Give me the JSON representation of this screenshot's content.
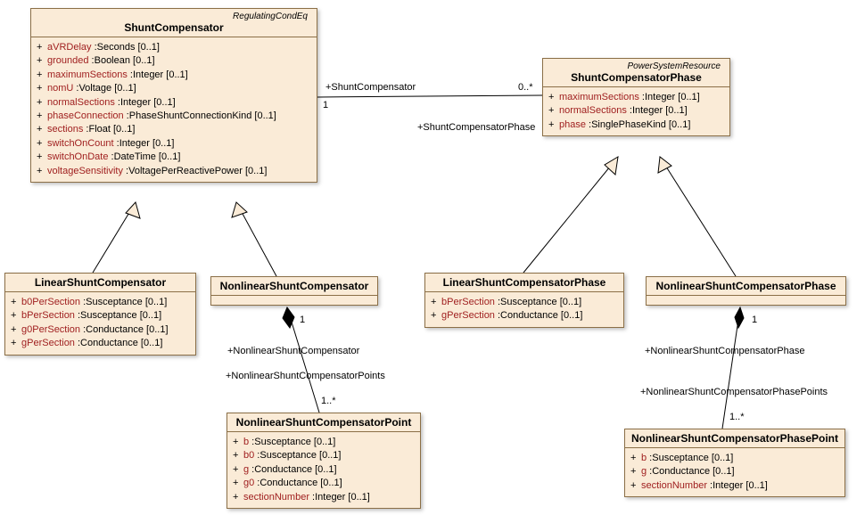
{
  "classes": {
    "shuntCompensator": {
      "stereotype": "RegulatingCondEq",
      "name": "ShuntCompensator",
      "attrs": [
        {
          "vis": "+",
          "name": "aVRDelay",
          "rest": "  :Seconds [0..1]"
        },
        {
          "vis": "+",
          "name": "grounded",
          "rest": "  :Boolean [0..1]"
        },
        {
          "vis": "+",
          "name": "maximumSections",
          "rest": "  :Integer [0..1]"
        },
        {
          "vis": "+",
          "name": "nomU",
          "rest": "  :Voltage [0..1]"
        },
        {
          "vis": "+",
          "name": "normalSections",
          "rest": "  :Integer [0..1]"
        },
        {
          "vis": "+",
          "name": "phaseConnection",
          "rest": "  :PhaseShuntConnectionKind [0..1]"
        },
        {
          "vis": "+",
          "name": "sections",
          "rest": "  :Float [0..1]"
        },
        {
          "vis": "+",
          "name": "switchOnCount",
          "rest": "  :Integer [0..1]"
        },
        {
          "vis": "+",
          "name": "switchOnDate",
          "rest": "  :DateTime [0..1]"
        },
        {
          "vis": "+",
          "name": "voltageSensitivity",
          "rest": "  :VoltagePerReactivePower [0..1]"
        }
      ]
    },
    "shuntCompensatorPhase": {
      "stereotype": "PowerSystemResource",
      "name": "ShuntCompensatorPhase",
      "attrs": [
        {
          "vis": "+",
          "name": "maximumSections",
          "rest": "  :Integer [0..1]"
        },
        {
          "vis": "+",
          "name": "normalSections",
          "rest": "  :Integer [0..1]"
        },
        {
          "vis": "+",
          "name": "phase",
          "rest": "  :SinglePhaseKind [0..1]"
        }
      ]
    },
    "linearShuntCompensator": {
      "name": "LinearShuntCompensator",
      "attrs": [
        {
          "vis": "+",
          "name": "b0PerSection",
          "rest": "  :Susceptance [0..1]"
        },
        {
          "vis": "+",
          "name": "bPerSection",
          "rest": "  :Susceptance [0..1]"
        },
        {
          "vis": "+",
          "name": "g0PerSection",
          "rest": "  :Conductance [0..1]"
        },
        {
          "vis": "+",
          "name": "gPerSection",
          "rest": "  :Conductance [0..1]"
        }
      ]
    },
    "nonlinearShuntCompensator": {
      "name": "NonlinearShuntCompensator",
      "attrs": []
    },
    "nonlinearShuntCompensatorPoint": {
      "name": "NonlinearShuntCompensatorPoint",
      "attrs": [
        {
          "vis": "+",
          "name": "b",
          "rest": "  :Susceptance [0..1]"
        },
        {
          "vis": "+",
          "name": "b0",
          "rest": "  :Susceptance [0..1]"
        },
        {
          "vis": "+",
          "name": "g",
          "rest": "  :Conductance [0..1]"
        },
        {
          "vis": "+",
          "name": "g0",
          "rest": "  :Conductance [0..1]"
        },
        {
          "vis": "+",
          "name": "sectionNumber",
          "rest": "  :Integer [0..1]"
        }
      ]
    },
    "linearShuntCompensatorPhase": {
      "name": "LinearShuntCompensatorPhase",
      "attrs": [
        {
          "vis": "+",
          "name": "bPerSection",
          "rest": "  :Susceptance [0..1]"
        },
        {
          "vis": "+",
          "name": "gPerSection",
          "rest": "  :Conductance [0..1]"
        }
      ]
    },
    "nonlinearShuntCompensatorPhase": {
      "name": "NonlinearShuntCompensatorPhase",
      "attrs": []
    },
    "nonlinearShuntCompensatorPhasePoint": {
      "name": "NonlinearShuntCompensatorPhasePoint",
      "attrs": [
        {
          "vis": "+",
          "name": "b",
          "rest": "  :Susceptance [0..1]"
        },
        {
          "vis": "+",
          "name": "g",
          "rest": "  :Conductance [0..1]"
        },
        {
          "vis": "+",
          "name": "sectionNumber",
          "rest": "  :Integer [0..1]"
        }
      ]
    }
  },
  "labels": {
    "assocSC": "+ShuntCompensator",
    "assocSCmult1": "1",
    "assocSCPmult": "0..*",
    "assocSCP": "+ShuntCompensatorPhase",
    "nsc1": "1",
    "nscRole": "+NonlinearShuntCompensator",
    "nscPointsRole": "+NonlinearShuntCompensatorPoints",
    "nscPointsMult": "1..*",
    "nscp1": "1",
    "nscpRole": "+NonlinearShuntCompensatorPhase",
    "nscpPointsRole": "+NonlinearShuntCompensatorPhasePoints",
    "nscpPointsMult": "1..*"
  },
  "chart_data": {
    "type": "uml-class-diagram",
    "classes": [
      {
        "name": "ShuntCompensator",
        "stereotype": "RegulatingCondEq",
        "attributes": [
          "aVRDelay:Seconds[0..1]",
          "grounded:Boolean[0..1]",
          "maximumSections:Integer[0..1]",
          "nomU:Voltage[0..1]",
          "normalSections:Integer[0..1]",
          "phaseConnection:PhaseShuntConnectionKind[0..1]",
          "sections:Float[0..1]",
          "switchOnCount:Integer[0..1]",
          "switchOnDate:DateTime[0..1]",
          "voltageSensitivity:VoltagePerReactivePower[0..1]"
        ]
      },
      {
        "name": "ShuntCompensatorPhase",
        "stereotype": "PowerSystemResource",
        "attributes": [
          "maximumSections:Integer[0..1]",
          "normalSections:Integer[0..1]",
          "phase:SinglePhaseKind[0..1]"
        ]
      },
      {
        "name": "LinearShuntCompensator",
        "attributes": [
          "b0PerSection:Susceptance[0..1]",
          "bPerSection:Susceptance[0..1]",
          "g0PerSection:Conductance[0..1]",
          "gPerSection:Conductance[0..1]"
        ]
      },
      {
        "name": "NonlinearShuntCompensator",
        "attributes": []
      },
      {
        "name": "NonlinearShuntCompensatorPoint",
        "attributes": [
          "b:Susceptance[0..1]",
          "b0:Susceptance[0..1]",
          "g:Conductance[0..1]",
          "g0:Conductance[0..1]",
          "sectionNumber:Integer[0..1]"
        ]
      },
      {
        "name": "LinearShuntCompensatorPhase",
        "attributes": [
          "bPerSection:Susceptance[0..1]",
          "gPerSection:Conductance[0..1]"
        ]
      },
      {
        "name": "NonlinearShuntCompensatorPhase",
        "attributes": []
      },
      {
        "name": "NonlinearShuntCompensatorPhasePoint",
        "attributes": [
          "b:Susceptance[0..1]",
          "g:Conductance[0..1]",
          "sectionNumber:Integer[0..1]"
        ]
      }
    ],
    "relationships": [
      {
        "type": "association",
        "from": "ShuntCompensator",
        "fromRole": "+ShuntCompensator",
        "fromMult": "1",
        "to": "ShuntCompensatorPhase",
        "toRole": "+ShuntCompensatorPhase",
        "toMult": "0..*"
      },
      {
        "type": "generalization",
        "child": "LinearShuntCompensator",
        "parent": "ShuntCompensator"
      },
      {
        "type": "generalization",
        "child": "NonlinearShuntCompensator",
        "parent": "ShuntCompensator"
      },
      {
        "type": "generalization",
        "child": "LinearShuntCompensatorPhase",
        "parent": "ShuntCompensatorPhase"
      },
      {
        "type": "generalization",
        "child": "NonlinearShuntCompensatorPhase",
        "parent": "ShuntCompensatorPhase"
      },
      {
        "type": "composition",
        "whole": "NonlinearShuntCompensator",
        "wholeRole": "+NonlinearShuntCompensator",
        "wholeMult": "1",
        "part": "NonlinearShuntCompensatorPoint",
        "partRole": "+NonlinearShuntCompensatorPoints",
        "partMult": "1..*"
      },
      {
        "type": "composition",
        "whole": "NonlinearShuntCompensatorPhase",
        "wholeRole": "+NonlinearShuntCompensatorPhase",
        "wholeMult": "1",
        "part": "NonlinearShuntCompensatorPhasePoint",
        "partRole": "+NonlinearShuntCompensatorPhasePoints",
        "partMult": "1..*"
      }
    ]
  }
}
